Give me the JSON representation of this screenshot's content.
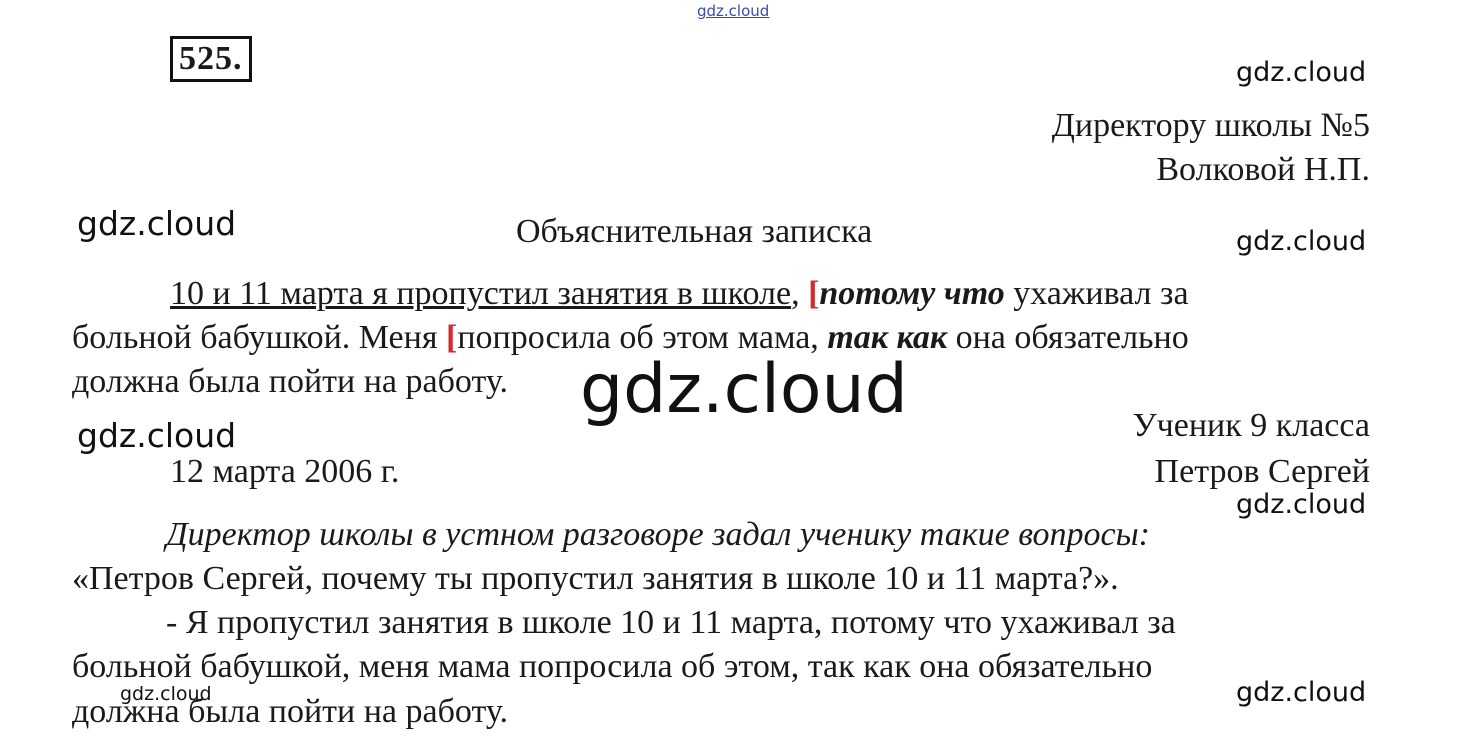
{
  "watermark": "gdz.cloud",
  "exercise_number": "525.",
  "addressee": {
    "line1": "Директору школы №5",
    "line2": "Волковой Н.П."
  },
  "title": "Объяснительная записка",
  "paragraph": {
    "part1_underlined": "10 и 11 марта я пропустил занятия в школе",
    "comma1": ",",
    "bracket1": "[",
    "conj1": "потому что",
    "part2": " ухаживал за",
    "line2_a": "больной бабушкой. Меня ",
    "bracket2": "[",
    "line2_b": "попросила об этом мама, ",
    "conj2": "так как",
    "line2_c": " она обязательно",
    "line3": "должна была пойти на работу."
  },
  "signature": {
    "line1": "Ученик 9 класса",
    "line2": "Петров Сергей",
    "date": "12 марта 2006 г."
  },
  "dialogue": {
    "intro": "Директор школы в устном разговоре задал ученику такие вопросы:",
    "question": "«Петров Сергей, почему ты пропустил занятия в школе 10 и 11 марта?».",
    "answer_line1": "- Я пропустил занятия в школе 10 и 11 марта, потому что ухаживал за",
    "answer_line2": "больной бабушкой, меня мама попросила об этом, так как она обязательно",
    "answer_line3": "должна была пойти на работу."
  }
}
